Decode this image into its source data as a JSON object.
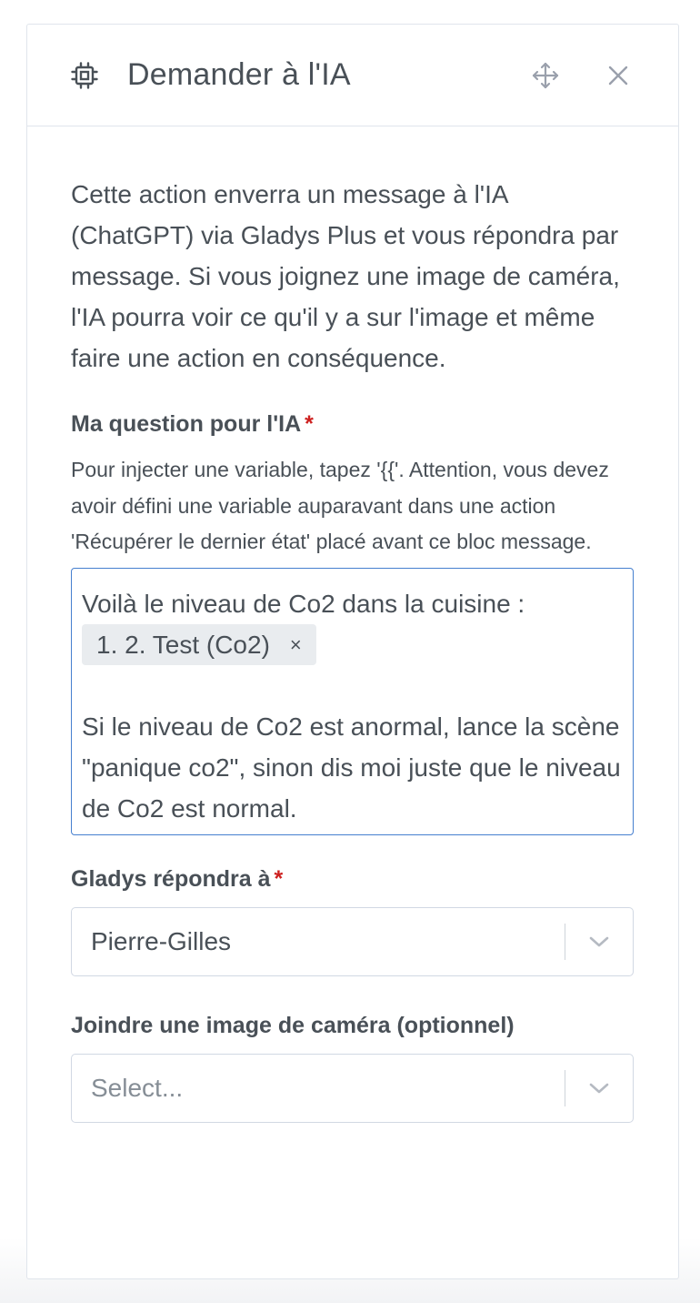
{
  "header": {
    "title": "Demander à l'IA",
    "icon": "cpu-chip-icon",
    "move_icon": "move-arrows-icon",
    "close_icon": "close-icon"
  },
  "description": "Cette action enverra un message à l'IA (ChatGPT) via Gladys Plus et vous répondra par message. Si vous joignez une image de caméra, l'IA pourra voir ce qu'il y a sur l'image et même faire une action en conséquence.",
  "question": {
    "label": "Ma question pour l'IA",
    "required_marker": "*",
    "help": "Pour injecter une variable, tapez '{{'. Attention, vous devez avoir défini une variable auparavant dans une action 'Récupérer le dernier état' placé avant ce bloc message.",
    "line1": "Voilà le niveau de Co2 dans la cuisine :",
    "variable_tag": "1. 2. Test (Co2)",
    "tag_remove": "×",
    "line2": "Si le niveau de Co2 est anormal, lance la scène \"panique co2\", sinon dis moi juste que le niveau de Co2 est normal."
  },
  "reply_to": {
    "label": "Gladys répondra à",
    "required_marker": "*",
    "value": "Pierre-Gilles"
  },
  "camera": {
    "label": "Joindre une image de caméra (optionnel)",
    "placeholder": "Select..."
  },
  "colors": {
    "focus_border": "#467fcf",
    "required": "#cd201f",
    "text": "#495057"
  }
}
